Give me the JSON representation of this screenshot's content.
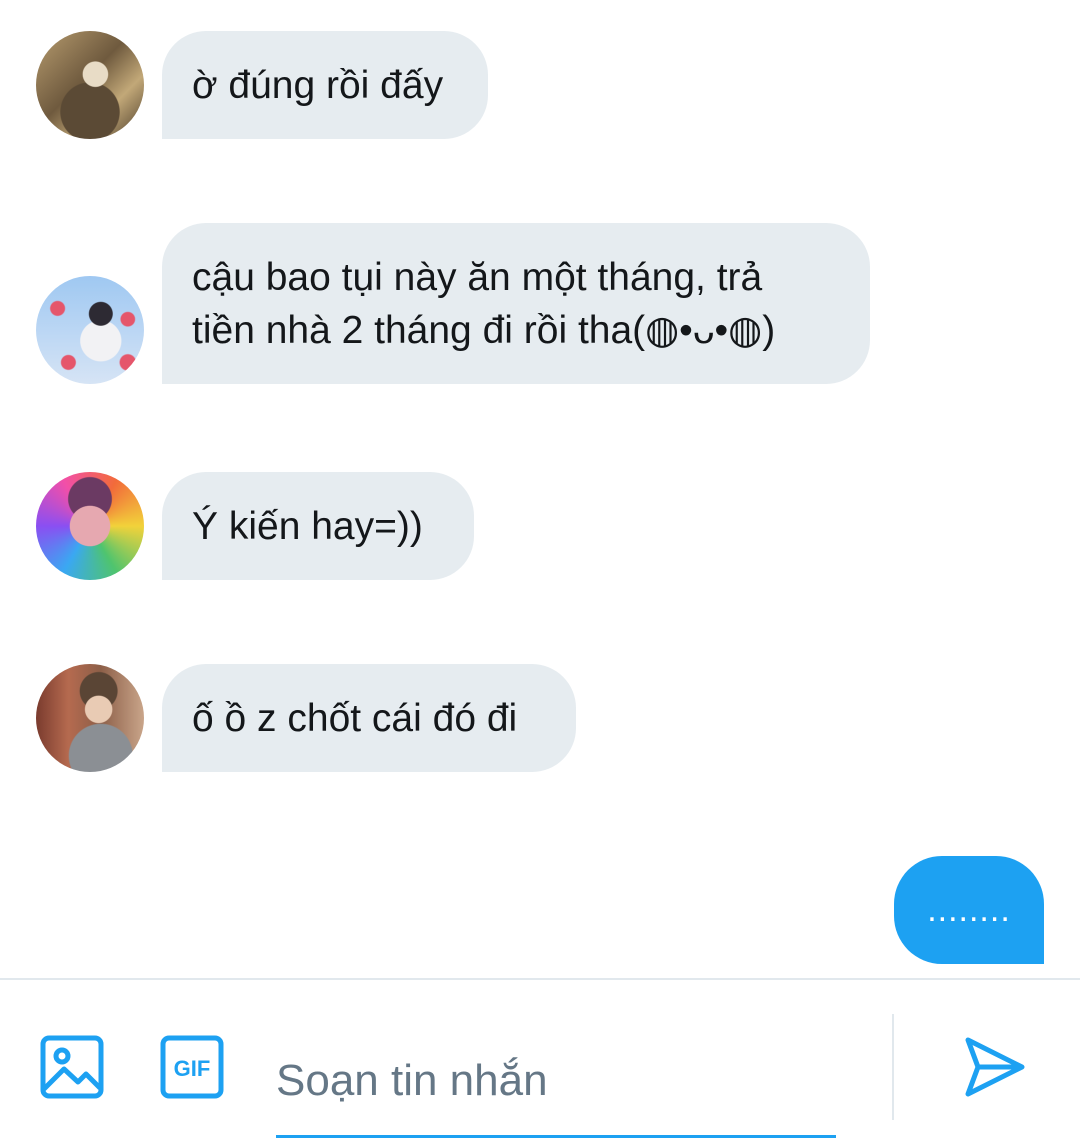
{
  "messages": [
    {
      "avatar": "user-avatar-1",
      "text": "ờ đúng rồi đấy"
    },
    {
      "avatar": "user-avatar-2",
      "text": "cậu bao tụi này ăn một tháng, trả\ntiền nhà 2 tháng đi rồi tha(◍•ᴗ•◍)"
    },
    {
      "avatar": "user-avatar-3",
      "text": "Ý kiến hay=))"
    },
    {
      "avatar": "user-avatar-4",
      "text": "ố ồ z chốt cái đó đi"
    }
  ],
  "sent_message": {
    "text": "........"
  },
  "composer": {
    "placeholder": "Soạn tin nhắn",
    "gif_label": "GIF"
  },
  "colors": {
    "accent": "#1da1f2",
    "bubble_received": "#e6ecf0",
    "text": "#14171a",
    "placeholder": "#657786"
  },
  "icons": [
    "image-icon",
    "gif-icon",
    "send-icon"
  ]
}
